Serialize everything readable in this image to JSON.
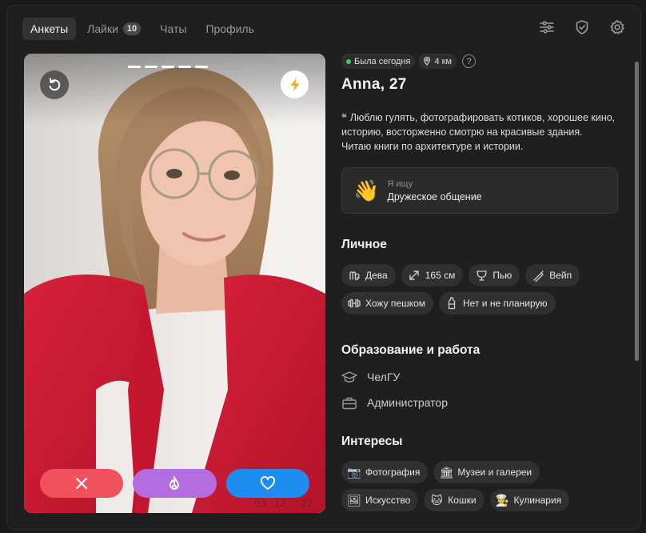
{
  "nav": {
    "tabs": [
      {
        "label": "Анкеты",
        "active": true
      },
      {
        "label": "Лайки",
        "badge": "10"
      },
      {
        "label": "Чаты"
      },
      {
        "label": "Профиль"
      }
    ],
    "icons": [
      "filters-icon",
      "shield-icon",
      "gear-icon"
    ]
  },
  "photo": {
    "stamp": "03 12 '22",
    "slides_total": 5,
    "slide_active": 1,
    "buttons": [
      "close-icon",
      "flame-icon",
      "heart-icon"
    ],
    "colors": {
      "nope": "#f0515c",
      "super": "#b46ddf",
      "like": "#1e8cf0"
    }
  },
  "profile": {
    "status": "Была сегодня",
    "distance": "4 км",
    "help": "?",
    "name": "Anna, 27",
    "bio": "Люблю гулять, фотографировать котиков, хорошее кино, историю, восторженно смотрю на красивые здания.\nЧитаю книги по архитектуре и истории.",
    "seeking": {
      "label": "Я ищу",
      "value": "Дружеское общение",
      "icon": "👋"
    }
  },
  "personal": {
    "title": "Личное",
    "chips": [
      {
        "icon": "zodiac-icon",
        "label": "Дева"
      },
      {
        "icon": "height-icon",
        "label": "165 см"
      },
      {
        "icon": "drink-icon",
        "label": "Пью"
      },
      {
        "icon": "vape-icon",
        "label": "Вейп"
      },
      {
        "icon": "dumbbell-icon",
        "label": "Хожу пешком"
      },
      {
        "icon": "bottle-icon",
        "label": "Нет и не планирую"
      }
    ]
  },
  "education": {
    "title": "Образование и работа",
    "school": "ЧелГУ",
    "job": "Администратор"
  },
  "interests": {
    "title": "Интересы",
    "chips": [
      {
        "emoji": "📷",
        "label": "Фотография"
      },
      {
        "emoji": "🏛",
        "label": "Музеи и галереи"
      },
      {
        "emoji": "🖼",
        "label": "Искусство"
      },
      {
        "emoji": "🐱",
        "label": "Кошки"
      },
      {
        "emoji": "👩‍🍳",
        "label": "Кулинария"
      }
    ]
  }
}
